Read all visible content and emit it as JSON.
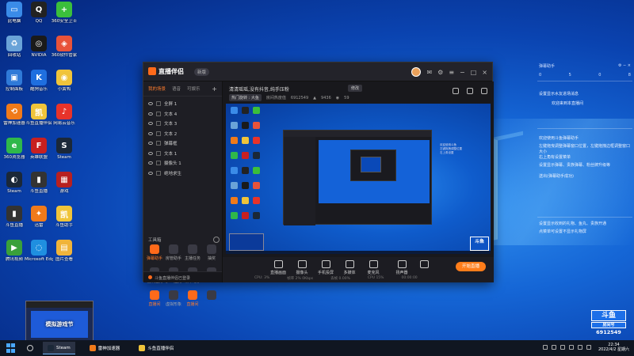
{
  "desktop": {
    "icons": [
      {
        "label": "此电脑",
        "color": "#3a8be8",
        "glyph": "▭"
      },
      {
        "label": "QQ",
        "color": "#222",
        "glyph": "Q"
      },
      {
        "label": "360安全卫士",
        "color": "#3bbf3b",
        "glyph": "+"
      },
      {
        "label": "回收站",
        "color": "#6aa3d8",
        "glyph": "♻"
      },
      {
        "label": "NVIDIA",
        "color": "#1a1a1a",
        "glyph": "◎"
      },
      {
        "label": "360软件管家",
        "color": "#e8533a",
        "glyph": "◈"
      },
      {
        "label": "控制面板",
        "color": "#2f7ad8",
        "glyph": "▣"
      },
      {
        "label": "酷狗音乐",
        "color": "#1f6fe0",
        "glyph": "K"
      },
      {
        "label": "小黄鸭",
        "color": "#f0c43a",
        "glyph": "◉"
      },
      {
        "label": "雷神加速器",
        "color": "#f07a1a",
        "glyph": "⟲"
      },
      {
        "label": "斗鱼直播伴侣",
        "color": "#f0c43a",
        "glyph": "凯"
      },
      {
        "label": "网易云音乐",
        "color": "#e8332a",
        "glyph": "♪"
      },
      {
        "label": "360浏览器",
        "color": "#2fb84a",
        "glyph": "e"
      },
      {
        "label": "英雄联盟",
        "color": "#c82020",
        "glyph": "F"
      },
      {
        "label": "Steam",
        "color": "#1b2838",
        "glyph": "S"
      },
      {
        "label": "Steam",
        "color": "#1b2838",
        "glyph": "◐"
      },
      {
        "label": "斗鱼直播",
        "color": "#333",
        "glyph": "▮"
      },
      {
        "label": "游戏",
        "color": "#b82020",
        "glyph": "▦"
      },
      {
        "label": "斗鱼直播",
        "color": "#333",
        "glyph": "▮"
      },
      {
        "label": "迅雷",
        "color": "#f07a1a",
        "glyph": "✦"
      },
      {
        "label": "斗鱼助手",
        "color": "#f0c43a",
        "glyph": "凯"
      },
      {
        "label": "腾讯视频",
        "color": "#3aa03a",
        "glyph": "▶"
      },
      {
        "label": "Microsoft Edge",
        "color": "#1f8fe0",
        "glyph": "◌"
      },
      {
        "label": "图片查看",
        "color": "#f0b43a",
        "glyph": "▤"
      }
    ]
  },
  "app": {
    "title": "直播伴侣",
    "version": "新版",
    "tabs": [
      "我的场景",
      "语音",
      "可娱乐"
    ],
    "scenes": [
      "全屏 1",
      "文本 4",
      "文本 3",
      "文本 2",
      "弹幕框",
      "文本 1",
      "摄像头 1",
      "绝地求生"
    ],
    "tools_label": "工具箱",
    "tools": [
      {
        "label": "弹幕助手",
        "hot": true
      },
      {
        "label": "房管助手",
        "hot": false
      },
      {
        "label": "主播任务",
        "hot": false
      },
      {
        "label": "抽奖",
        "hot": false
      },
      {
        "label": "视频连麦",
        "hot": false
      },
      {
        "label": "多人连麦",
        "hot": false
      },
      {
        "label": "精华助手",
        "hot": false
      },
      {
        "label": "",
        "hot": false
      },
      {
        "label": "直播间",
        "hot": true
      },
      {
        "label": "虚拟形象",
        "hot": false
      },
      {
        "label": "直播间",
        "hot": true
      },
      {
        "label": "",
        "hot": false
      }
    ],
    "login_status": "斗鱼直播伴侣已登录",
    "room_title": "清清瑶瑶,没有抖音,纯手压粉",
    "modify_label": "修改",
    "room_meta": {
      "rank": "热门旋转 : 大鱼",
      "fans_label": "房间热度值",
      "fans": "6912549",
      "hot": "9436",
      "online": "59"
    },
    "preview_side_text": [
      "欢迎使用斗鱼",
      "左键拖拽调整位置",
      "右上角设置"
    ],
    "bottom_tools": [
      "直播画面",
      "摄像头",
      "手机投屏",
      "多媒体",
      "麦克风",
      "扬声器",
      ""
    ],
    "live_button": "开始直播",
    "stats": [
      "CPU: 3%",
      "帧率 2% 0Kbps",
      "丢帧 0.00%",
      "CPU 15%",
      "00:00:00"
    ]
  },
  "chat_panel": {
    "title": "弹幕助手",
    "stats": [
      "0",
      "5",
      "0",
      "8"
    ],
    "lines": [
      "设置显示水友进场消息",
      "欢迎来到本直播间",
      "欢迎使用斗鱼弹幕助手",
      "左键拖曳调整弹幕窗口位置，左键拖拽边框调整窗口大小",
      "右上角有设置菜单",
      "设置显示弹幕、贵族弹幕、粉丝牌升级等",
      "送出(弹幕助手成功)",
      "设置显示收到的礼物、鱼丸、贵族开通",
      "点菜单可设置不显示礼物屏"
    ]
  },
  "douyu": {
    "logo": "斗鱼",
    "sub": "房间号",
    "room_id": "6912549"
  },
  "mini_preview": {
    "text": "模拟游戏节"
  },
  "taskbar": {
    "items": [
      {
        "label": "Steam",
        "color": "#1b2838",
        "active": true
      },
      {
        "label": "雷神加速器",
        "color": "#f07a1a",
        "active": false
      },
      {
        "label": "斗鱼直播伴侣",
        "color": "#f0c43a",
        "active": false
      }
    ],
    "time": "22:34",
    "date": "2022/4/2 星期六"
  }
}
